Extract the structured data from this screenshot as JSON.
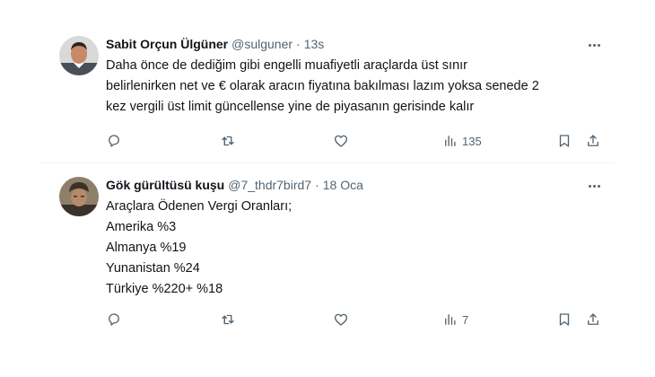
{
  "tweets": [
    {
      "name": "Sabit Orçun Ülgüner",
      "handle": "@sulguner",
      "separator": "·",
      "time": "13s",
      "lines": [
        "Daha önce de dediğim gibi engelli muafiyetli araçlarda üst sınır",
        "belirlenirken net ve € olarak aracın fiyatına bakılması lazım yoksa senede 2",
        "kez vergili üst limit güncellense yine de piyasanın gerisinde kalır"
      ],
      "views": "135"
    },
    {
      "name": "Gök gürültüsü kuşu",
      "handle": "@7_thdr7bird7",
      "separator": "·",
      "time": "18 Oca",
      "lines": [
        "Araçlara Ödenen Vergi Oranları;",
        "Amerika %3",
        "Almanya %19",
        "Yunanistan %24",
        "Türkiye %220+ %18"
      ],
      "views": "7"
    }
  ],
  "icons": {
    "reply": "reply-icon",
    "retweet": "retweet-icon",
    "like": "heart-icon",
    "views": "views-icon",
    "bookmark": "bookmark-icon",
    "share": "share-icon",
    "more": "more-icon"
  },
  "colors": {
    "text": "#0f1419",
    "secondary": "#536471",
    "divider": "#eff3f4"
  }
}
